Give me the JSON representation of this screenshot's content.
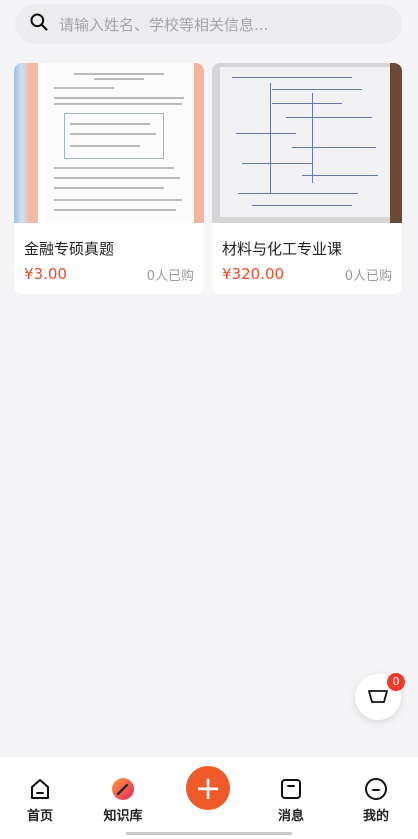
{
  "search": {
    "placeholder": "请输入姓名、学校等相关信息..."
  },
  "products": [
    {
      "title": "金融专硕真题",
      "price": "¥3.00",
      "sold": "0人已购"
    },
    {
      "title": "材料与化工专业课",
      "price": "¥320.00",
      "sold": "0人已购"
    }
  ],
  "cart": {
    "badge": "0"
  },
  "tabbar": {
    "home": "首页",
    "knowledge": "知识库",
    "add": "+",
    "messages": "消息",
    "me": "我的"
  },
  "colors": {
    "accent": "#f05a2b",
    "price": "#f04a2a",
    "badge": "#ee3b2d"
  }
}
